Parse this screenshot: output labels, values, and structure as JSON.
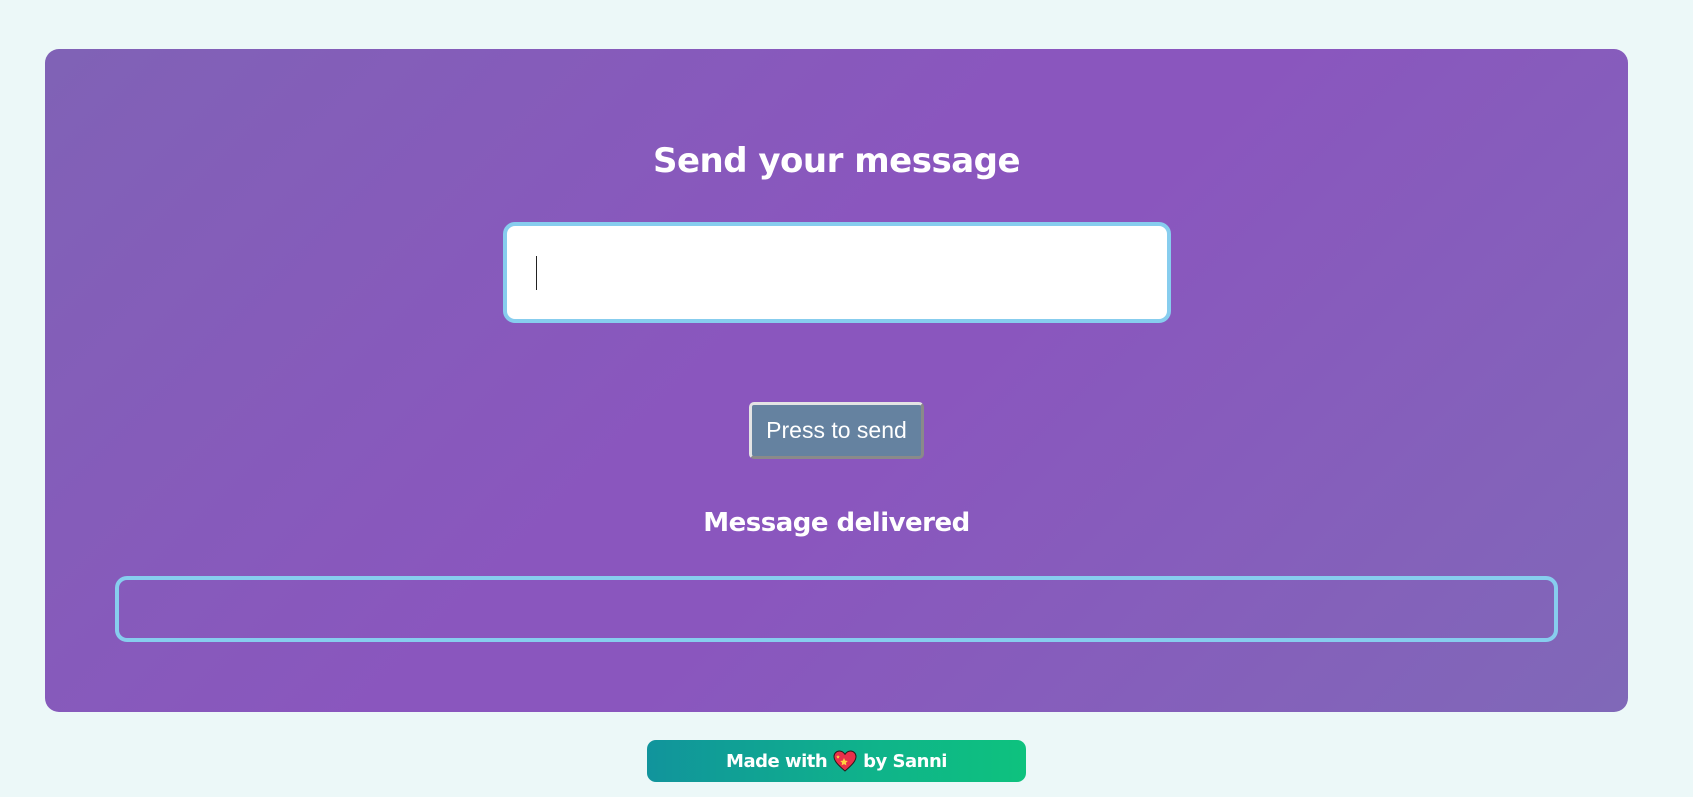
{
  "card": {
    "title": "Send your message",
    "input": {
      "value": "",
      "placeholder": ""
    },
    "send_button_label": "Press to send",
    "status_text": "Message delivered",
    "output_value": ""
  },
  "footer": {
    "prefix": "Made with",
    "icon": "sparkling-heart-icon",
    "suffix": "by Sanni"
  },
  "colors": {
    "page_background": "#ecf8f8",
    "card_gradient": [
      "#8062b6",
      "#8a56be",
      "#8068b8"
    ],
    "input_border": "#87cdee",
    "button_background": "#6582a0",
    "footer_gradient": [
      "#11949c",
      "#0ec27e"
    ]
  }
}
